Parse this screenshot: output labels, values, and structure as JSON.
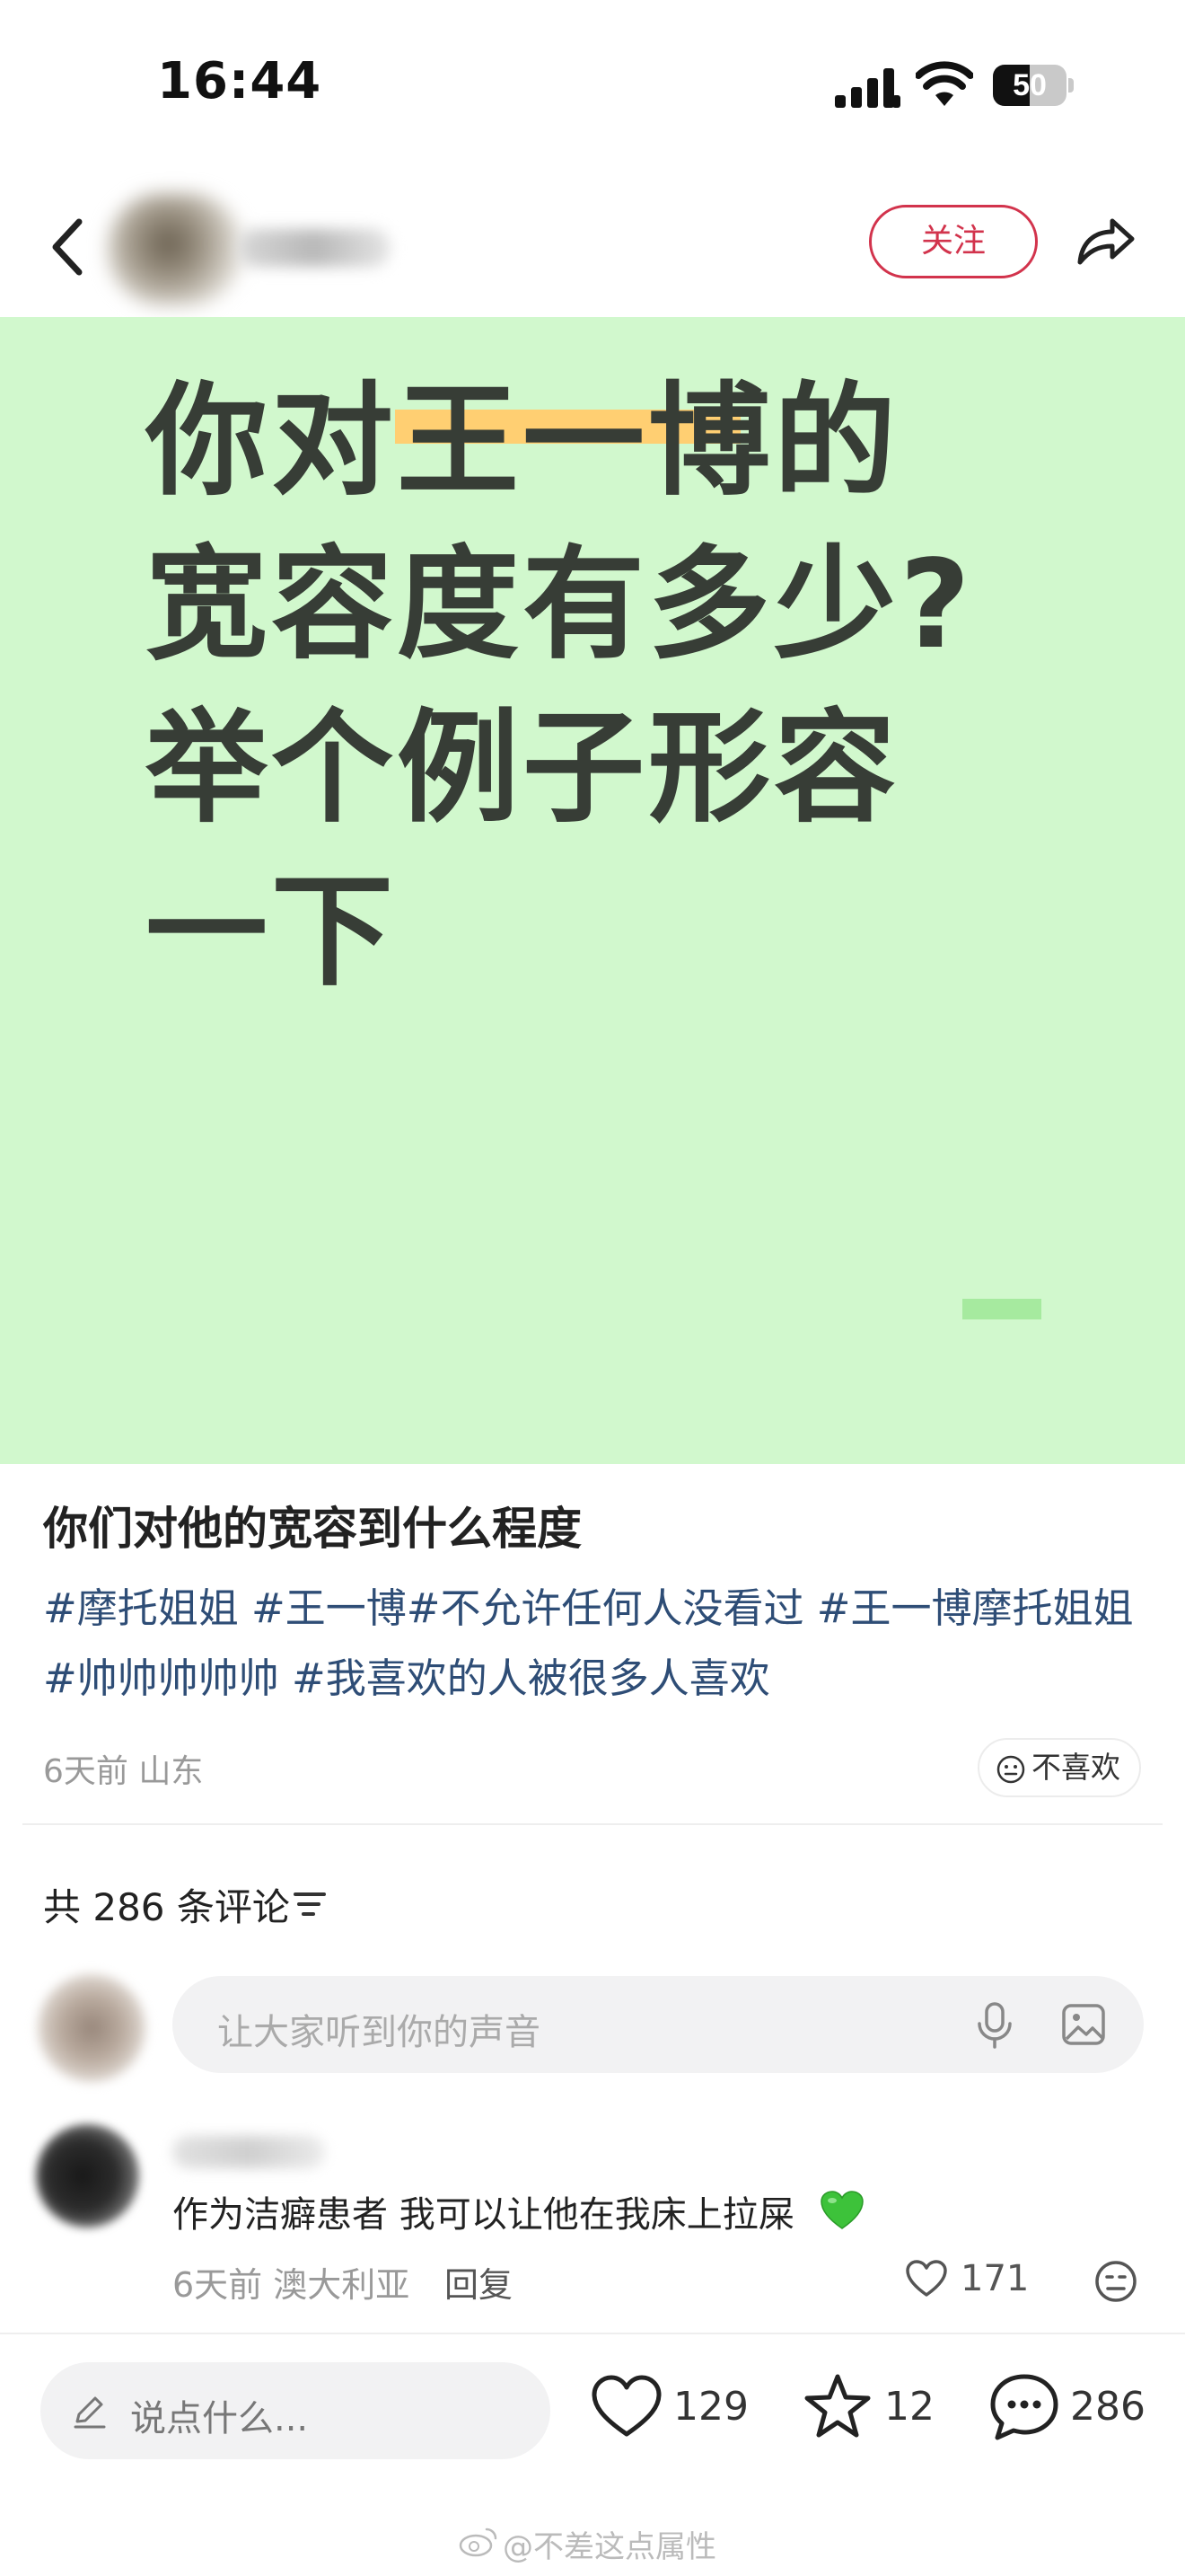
{
  "status_bar": {
    "time": "16:44",
    "battery": "50",
    "battery_level": 0.5
  },
  "header": {
    "follow_label": "关注"
  },
  "banner": {
    "lines": [
      "你对王一博的",
      "宽容度有多少?",
      "举个例子形容",
      "一下"
    ],
    "background": "#d1f8cd",
    "highlight_color": "#ffcf72"
  },
  "post": {
    "title": "你们对他的宽容到什么程度",
    "tags": [
      "#摩托姐姐",
      "#王一博",
      "#不允许任何人没看过",
      "#王一博摩托姐姐",
      "#帅帅帅帅帅",
      "#我喜欢的人被很多人喜欢"
    ],
    "meta": "6天前 山东",
    "dislike_label": "不喜欢"
  },
  "comments": {
    "count_label": "共 286 条评论",
    "input_placeholder": "让大家听到你的声音",
    "items": [
      {
        "text": "作为洁癖患者 我可以让他在我床上拉屎",
        "meta": "6天前 澳大利亚",
        "reply_label": "回复",
        "likes": "171"
      }
    ]
  },
  "bottom_bar": {
    "input_placeholder": "说点什么...",
    "likes": "129",
    "favorites": "12",
    "comments": "286"
  },
  "watermark": "@不差这点属性",
  "colors": {
    "accent": "#d2334c",
    "tag": "#2e4d76"
  }
}
